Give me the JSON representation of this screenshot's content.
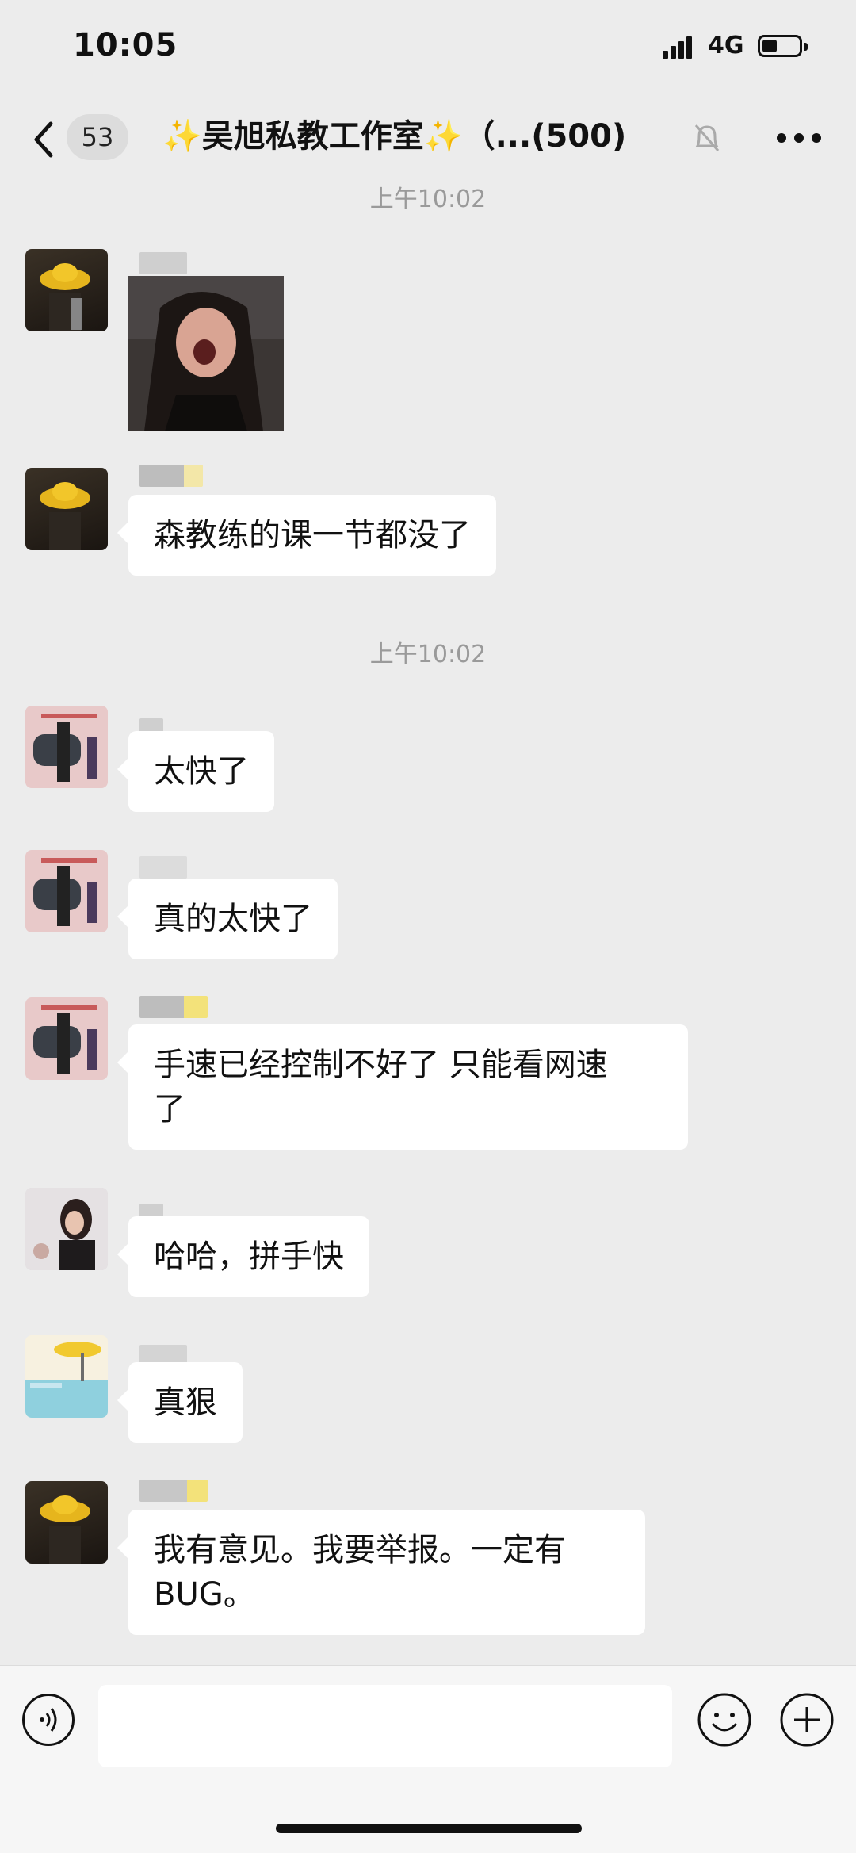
{
  "status_bar": {
    "time": "10:05",
    "network": "4G",
    "battery_level": 0.4
  },
  "header": {
    "unread_count": "53",
    "title": "✨吴旭私教工作室✨（...(500)"
  },
  "timestamps": [
    "上午10:02",
    "上午10:02"
  ],
  "messages": [
    {
      "text": "森教练的课一节都没了"
    },
    {
      "text": "太快了"
    },
    {
      "text": "真的太快了"
    },
    {
      "text": "手速已经控制不好了 只能看网速\n了"
    },
    {
      "text": "哈哈，拼手快"
    },
    {
      "text": "真狠"
    },
    {
      "text": "我有意见。我要举报。一定有\nBUG。"
    }
  ],
  "icons": {
    "back": "chevron-left-icon",
    "mute": "bell-off-icon",
    "more": "more-icon",
    "voice": "voice-icon",
    "emoji": "smiley-icon",
    "plus": "plus-icon"
  }
}
